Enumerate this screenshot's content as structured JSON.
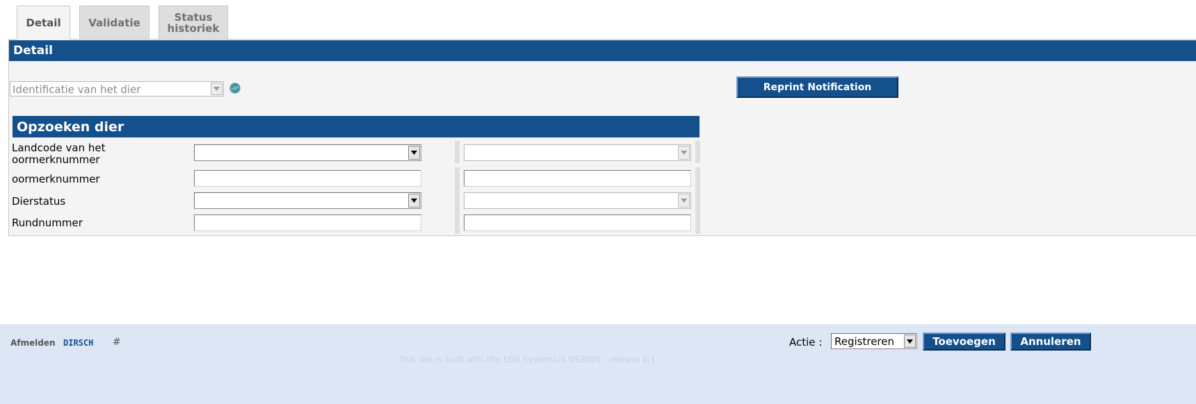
{
  "tabs": [
    {
      "label": "Detail",
      "active": true
    },
    {
      "label": "Validatie",
      "active": false
    },
    {
      "label": "Status historiek",
      "active": false
    }
  ],
  "panel": {
    "title": "Detail",
    "identification_select": {
      "value": "Identificatie van het dier"
    },
    "refresh_icon": "recycle-icon",
    "reprint_button": "Reprint Notification"
  },
  "search": {
    "title": "Opzoeken dier",
    "fields": [
      {
        "label": "Landcode van het oormerknummer",
        "type": "select",
        "value": "",
        "value2": ""
      },
      {
        "label": "oormerknummer",
        "type": "input",
        "value": "",
        "value2": ""
      },
      {
        "label": "Dierstatus",
        "type": "select",
        "value": "",
        "value2": ""
      },
      {
        "label": "Rundnummer",
        "type": "input",
        "value": "",
        "value2": ""
      }
    ]
  },
  "footer": {
    "logout_label": "Afmelden",
    "user": "DIRSCH",
    "hash": "#",
    "action_label": "Actie :",
    "action_value": "Registreren",
    "add_button": "Toevoegen",
    "cancel_button": "Annuleren",
    "credit": "This site is built with the EDS.SystemLib VS2005 - release 8.1"
  },
  "colors": {
    "header_bar": "#13508c",
    "footer_bg": "#dde6f4",
    "panel_bg": "#f4f4f4"
  }
}
